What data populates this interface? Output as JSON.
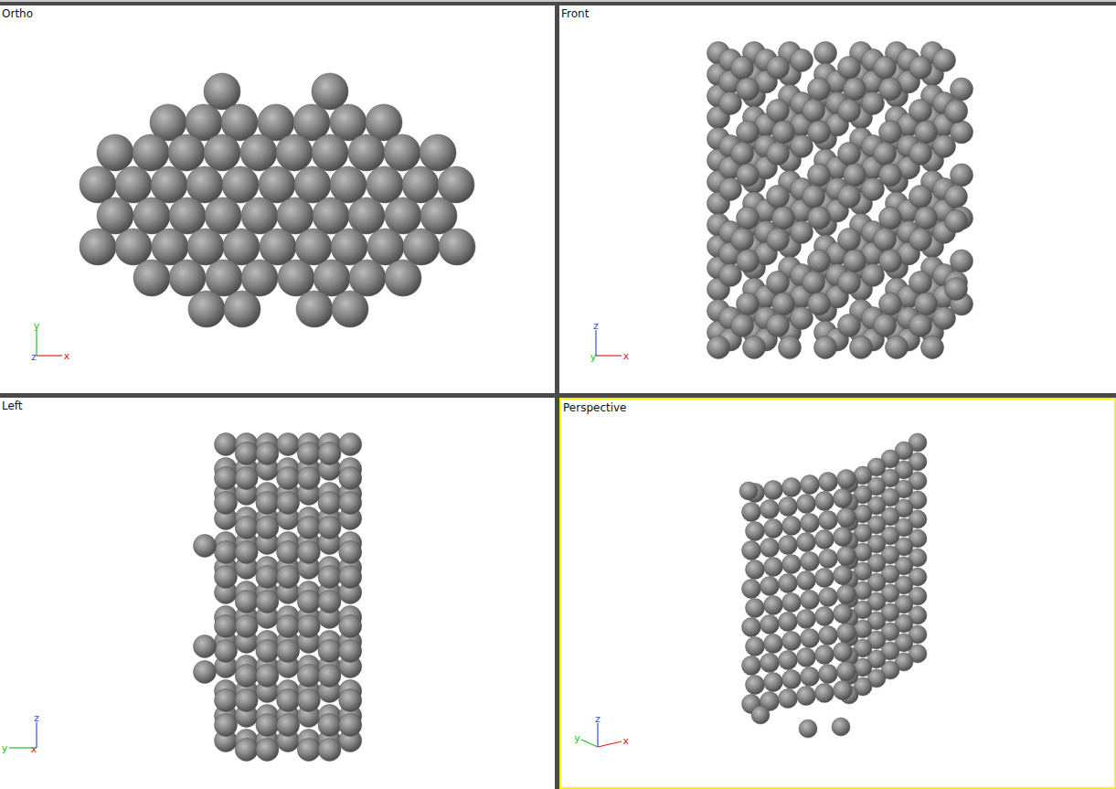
{
  "viewports": [
    {
      "label": "Ortho",
      "selected": false,
      "axes": [
        {
          "label": "x",
          "color": "#e02020"
        },
        {
          "label": "y",
          "color": "#20c020"
        },
        {
          "label": "z",
          "color": "#3050e0"
        }
      ]
    },
    {
      "label": "Front",
      "selected": false,
      "axes": [
        {
          "label": "x",
          "color": "#e02020"
        },
        {
          "label": "y",
          "color": "#20c020"
        },
        {
          "label": "z",
          "color": "#3050e0"
        }
      ]
    },
    {
      "label": "Left",
      "selected": false,
      "axes": [
        {
          "label": "x",
          "color": "#e02020"
        },
        {
          "label": "y",
          "color": "#20c020"
        },
        {
          "label": "z",
          "color": "#3050e0"
        }
      ]
    },
    {
      "label": "Perspective",
      "selected": true,
      "axes": [
        {
          "label": "x",
          "color": "#e02020"
        },
        {
          "label": "y",
          "color": "#20c020"
        },
        {
          "label": "z",
          "color": "#3050e0"
        }
      ]
    }
  ]
}
